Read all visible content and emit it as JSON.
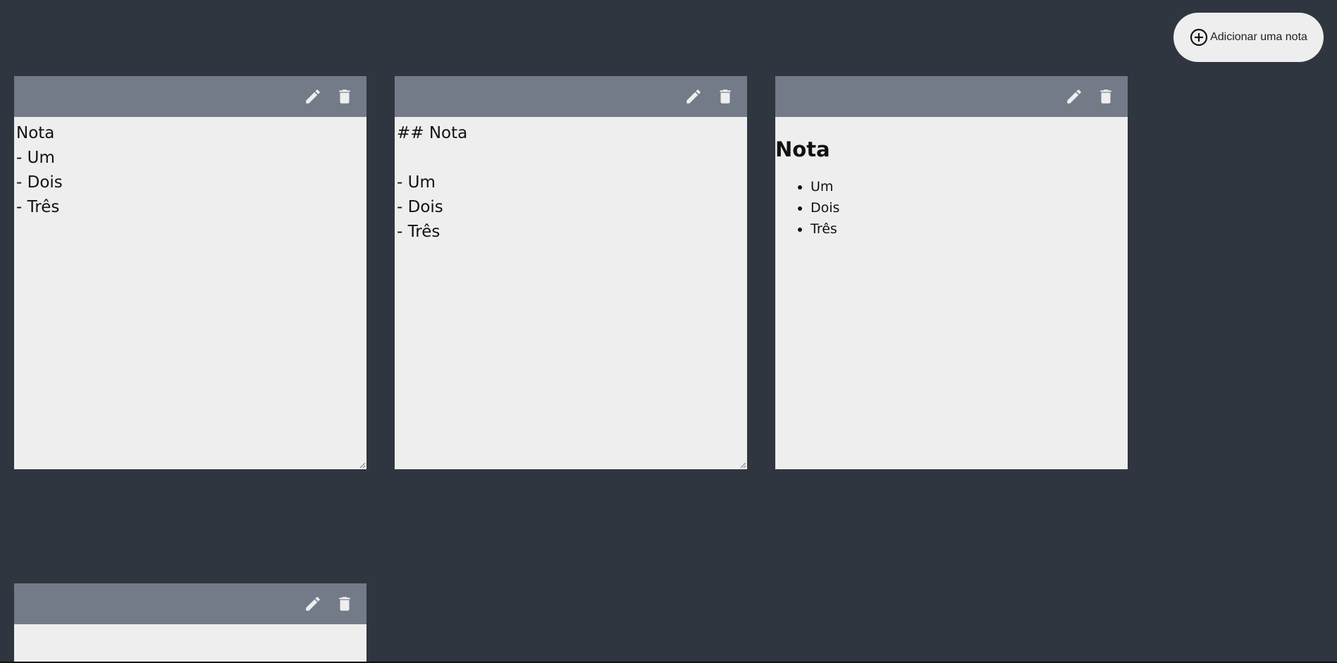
{
  "header": {
    "add_button_label": "Adicionar uma nota"
  },
  "notes": [
    {
      "mode": "edit",
      "text": "Nota\n- Um\n- Dois\n- Três"
    },
    {
      "mode": "edit",
      "text": "## Nota\n\n- Um\n- Dois\n- Três"
    },
    {
      "mode": "preview",
      "heading": "Nota",
      "items": [
        "Um",
        "Dois",
        "Três"
      ]
    },
    {
      "mode": "edit",
      "text": ""
    }
  ],
  "icons": {
    "add": "plus-circle-icon",
    "edit": "pencil-icon",
    "delete": "trash-icon"
  },
  "colors": {
    "background": "#2f3640",
    "toolbar": "#737b89",
    "note_body": "#eeeeee",
    "button_bg": "#eeeeee"
  }
}
